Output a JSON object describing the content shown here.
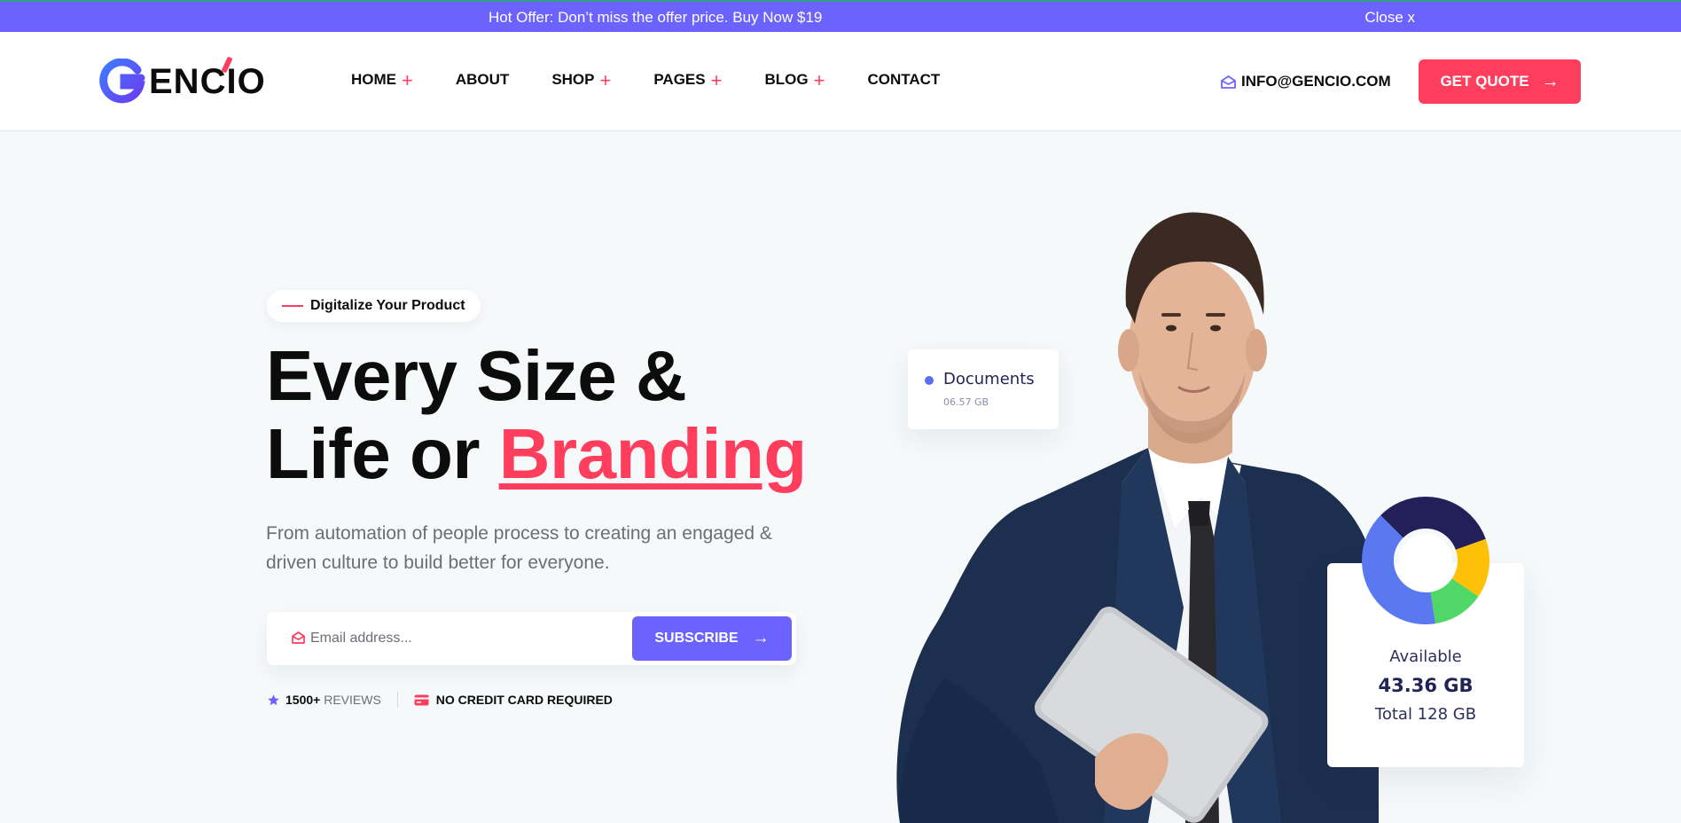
{
  "promo": {
    "message": "Hot Offer: Don’t miss the offer price. Buy Now $19",
    "close_label": "Close x"
  },
  "brand": {
    "logo_mark": "G",
    "logo_text": "ENCIO"
  },
  "nav": {
    "items": [
      {
        "label": "HOME",
        "has_submenu": true
      },
      {
        "label": "ABOUT",
        "has_submenu": false
      },
      {
        "label": "SHOP",
        "has_submenu": true
      },
      {
        "label": "PAGES",
        "has_submenu": true
      },
      {
        "label": "BLOG",
        "has_submenu": true
      },
      {
        "label": "CONTACT",
        "has_submenu": false
      }
    ],
    "plus_symbol": "+"
  },
  "contact": {
    "email": "INFO@GENCIO.COM"
  },
  "cta": {
    "quote_label": "GET QUOTE",
    "arrow": "→"
  },
  "hero": {
    "tag": "Digitalize Your Product",
    "headline_line1": "Every Size &",
    "headline_line2_prefix": "Life or ",
    "headline_accent": "Branding",
    "subtext": "From automation of people process to creating an engaged & driven culture to build better for everyone.",
    "email_placeholder": "Email address...",
    "subscribe_label": "SUBSCRIBE",
    "arrow": "→",
    "reviews_count": "1500+",
    "reviews_label": "REVIEWS",
    "no_card_label": "NO CREDIT CARD REQUIRED"
  },
  "documents_card": {
    "title": "Documents",
    "size": "06.57 GB"
  },
  "storage_card": {
    "available_label": "Available",
    "available_value": "43.36 GB",
    "total_label": "Total 128 GB",
    "segments": [
      {
        "color": "#232059",
        "fraction": 0.32
      },
      {
        "color": "#ffc107",
        "fraction": 0.15
      },
      {
        "color": "#4fd868",
        "fraction": 0.13
      },
      {
        "color": "#5a78f0",
        "fraction": 0.4
      }
    ]
  },
  "colors": {
    "primary": "#6c63ff",
    "accent": "#ff3d5d",
    "dark": "#0c0c0c",
    "muted": "#6b6f75",
    "background": "#f5f9fa"
  },
  "icons": {
    "mail": "envelope-open-icon",
    "arrow": "arrow-right-icon",
    "star": "star-icon",
    "card": "credit-card-icon"
  }
}
